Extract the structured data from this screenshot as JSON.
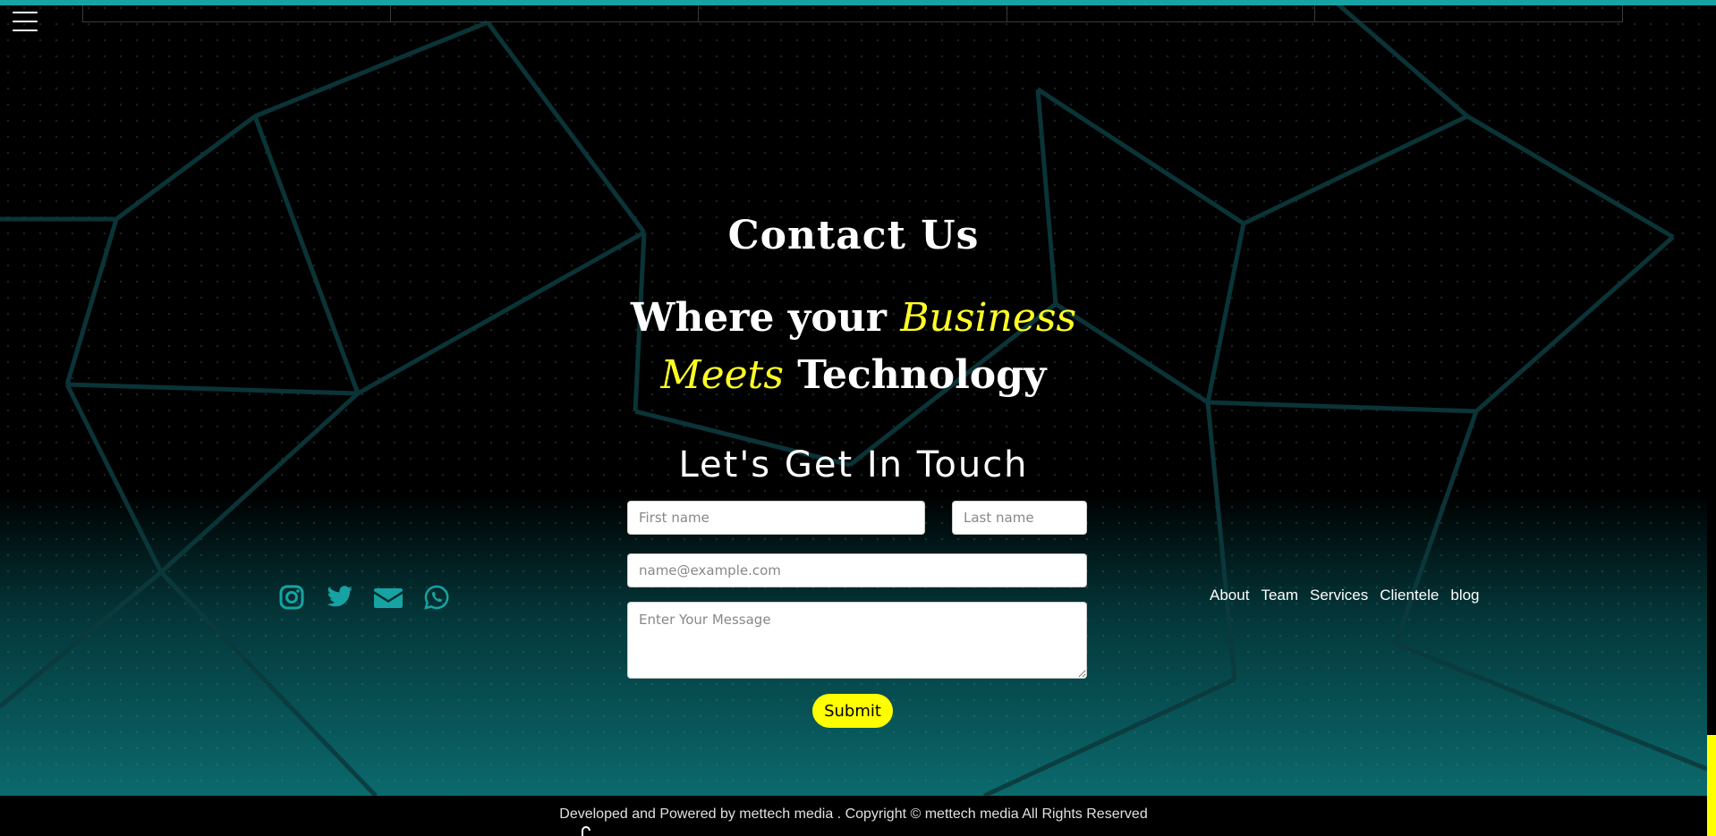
{
  "contact": {
    "heading": "Contact Us",
    "tagline_part1": "Where your ",
    "tagline_script1": "Business",
    "tagline_script2": "Meets",
    "tagline_part2": " Technology",
    "touch_heading": "Let's Get In Touch"
  },
  "form": {
    "first_name_placeholder": "First name",
    "last_name_placeholder": "Last name",
    "email_placeholder": "name@example.com",
    "message_placeholder": "Enter Your Message",
    "submit_label": "Submit"
  },
  "social": [
    "instagram-icon",
    "twitter-icon",
    "envelope-icon",
    "whatsapp-icon"
  ],
  "nav": {
    "about": "About",
    "team": "Team",
    "services": "Services",
    "clientele": "Clientele",
    "blog": "blog"
  },
  "footer": {
    "text": "Developed and Powered by mettech media . Copyright © mettech media All Rights Reserved"
  },
  "colors": {
    "accent_teal": "#17a3a3",
    "accent_yellow": "#ffff00"
  }
}
